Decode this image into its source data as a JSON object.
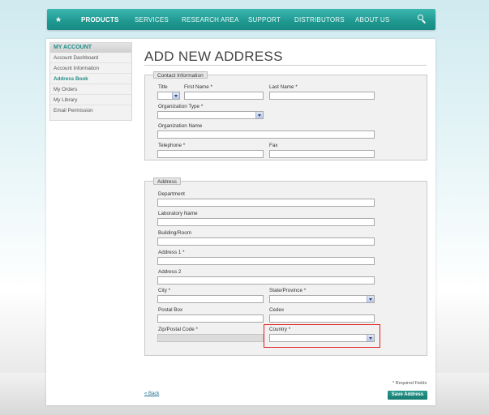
{
  "nav": {
    "items": [
      {
        "label": "PRODUCTS",
        "active": true
      },
      {
        "label": "SERVICES"
      },
      {
        "label": "RESEARCH AREA"
      },
      {
        "label": "SUPPORT"
      },
      {
        "label": "DISTRIBUTORS"
      },
      {
        "label": "ABOUT US"
      }
    ]
  },
  "sidebar": {
    "title": "MY ACCOUNT",
    "items": [
      {
        "label": "Account Dashboard"
      },
      {
        "label": "Account Information"
      },
      {
        "label": "Address Book",
        "active": true
      },
      {
        "label": "My Orders"
      },
      {
        "label": "My Library"
      },
      {
        "label": "Email Permission"
      }
    ]
  },
  "page": {
    "title": "ADD NEW ADDRESS"
  },
  "contact": {
    "legend": "Contact Information",
    "title_label": "Title",
    "first_name_label": "First Name *",
    "last_name_label": "Last Name *",
    "org_type_label": "Organization Type *",
    "org_name_label": "Organization Name",
    "telephone_label": "Telephone *",
    "fax_label": "Fax"
  },
  "address": {
    "legend": "Address",
    "department_label": "Department",
    "lab_name_label": "Laboratory Name",
    "building_label": "Building/Room",
    "address1_label": "Address 1 *",
    "address2_label": "Address 2",
    "city_label": "City *",
    "state_label": "State/Province *",
    "postal_box_label": "Postal Box",
    "cedex_label": "Cedex",
    "zip_label": "Zip/Postal Code *",
    "country_label": "Country *"
  },
  "footer": {
    "required_star": "*",
    "required_text": " Required Fields",
    "back_label": "« Back",
    "save_label": "Save Address"
  },
  "colors": {
    "accent": "#1f9890",
    "highlight": "#e02020"
  }
}
